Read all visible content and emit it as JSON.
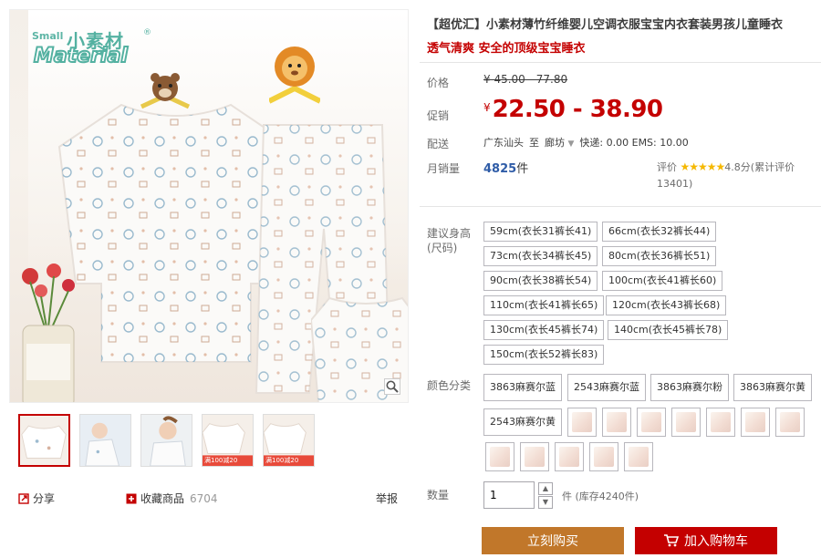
{
  "brand": {
    "small": "Small",
    "cn": "小素材",
    "en": "Material",
    "registered": "®"
  },
  "gallery": {
    "thumbnails": [
      "thumb-1",
      "thumb-2",
      "thumb-3",
      "thumb-4",
      "thumb-5"
    ],
    "thumb_badges": [
      "满100减20",
      "满100减20"
    ],
    "share_label": "分享",
    "collect_label": "收藏商品",
    "collect_count": "6704",
    "report_label": "举报"
  },
  "product": {
    "title": "【超优汇】小素材薄竹纤维婴儿空调衣服宝宝内衣套装男孩儿童睡衣",
    "subtitle": "透气清爽 安全的顶级宝宝睡衣",
    "price_label": "价格",
    "original_price": "¥ 45.00 - 77.80",
    "promo_label": "促销",
    "currency": "¥",
    "promo_price": "22.50 - 38.90",
    "shipping_label": "配送",
    "ship_from": "广东汕头",
    "ship_to_word": "至",
    "ship_to": "廊坊",
    "ship_fees": "快递: 0.00 EMS: 10.00",
    "sales_label": "月销量",
    "sales_count": "4825",
    "sales_unit": "件",
    "rating_label": "评价",
    "rating_stars": "★★★★★",
    "rating_text": "4.8分(累计评价13401)"
  },
  "options": {
    "size_label": "建议身高(尺码)",
    "sizes": [
      "59cm(衣长31裤长41)",
      "66cm(衣长32裤长44)",
      "73cm(衣长34裤长45)",
      "80cm(衣长36裤长51)",
      "90cm(衣长38裤长54)",
      "100cm(衣长41裤长60)",
      "110cm(衣长41裤长65)",
      "120cm(衣长43裤长68)",
      "130cm(衣长45裤长74)",
      "140cm(衣长45裤长78)",
      "150cm(衣长52裤长83)"
    ],
    "color_label": "颜色分类",
    "colors": [
      "3863麻赛尔蓝",
      "2543麻赛尔蓝",
      "3863麻赛尔粉",
      "3863麻赛尔黄",
      "2543麻赛尔黄"
    ],
    "swatch_count": 12
  },
  "purchase": {
    "qty_label": "数量",
    "qty_value": "1",
    "stock_text": "件 (库存4240件)",
    "buy_now_label": "立刻购买",
    "add_cart_label": "加入购物车"
  },
  "colors": {
    "accent": "#c40000",
    "buy_now": "#c1772a",
    "brand": "#54b1a1",
    "link": "#2f5ca7"
  }
}
